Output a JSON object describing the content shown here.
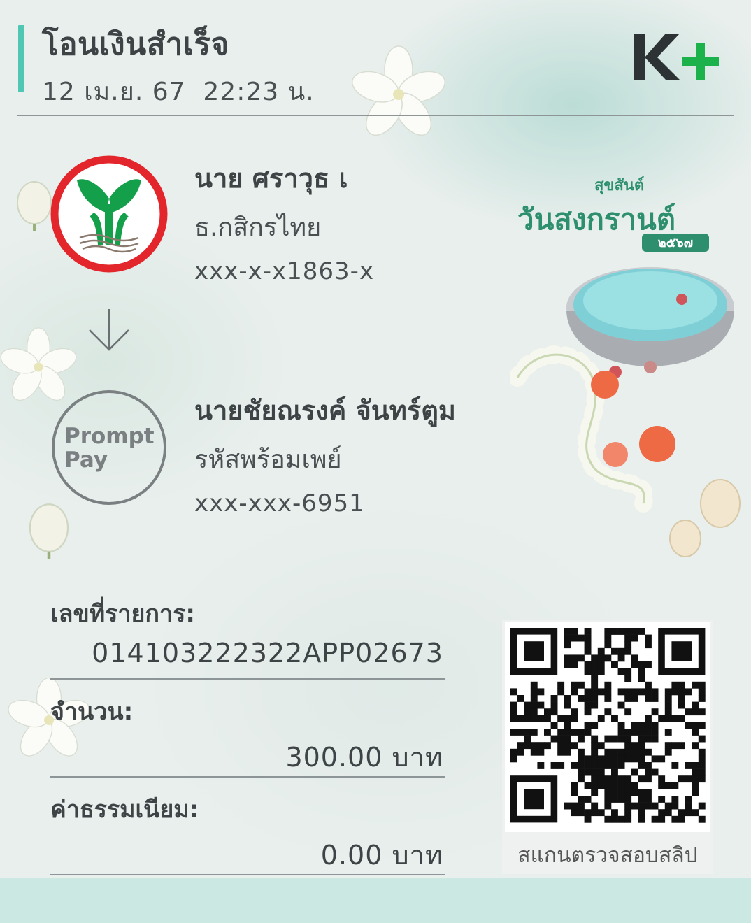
{
  "header": {
    "title": "โอนเงินสำเร็จ",
    "datetime": "12 เม.ย. 67  22:23 น.",
    "brand_logo": "K+"
  },
  "sender": {
    "name": "นาย ศราวุธ เ",
    "bank": "ธ.กสิกรไทย",
    "account": "xxx-x-x1863-x",
    "logo_icon": "kasikorn-bank-logo"
  },
  "transfer_arrow_icon": "arrow-down-icon",
  "receiver": {
    "name": "นายชัยณรงค์ จันทร์ตูม",
    "bank": "รหัสพร้อมเพย์",
    "account": "xxx-xxx-6951",
    "logo_icon": "promptpay-logo",
    "logo_text_line1": "Prompt",
    "logo_text_line2": "Pay"
  },
  "details": [
    {
      "label": "เลขที่รายการ:",
      "value": "014103222322APP02673"
    },
    {
      "label": "จำนวน:",
      "value": "300.00 บาท"
    },
    {
      "label": "ค่าธรรมเนียม:",
      "value": "0.00 บาท"
    }
  ],
  "qr": {
    "caption": "สแกนตรวจสอบสลิป"
  },
  "festival": {
    "line1": "สุขสันต์",
    "line2": "วันสงกรานต์",
    "year": "๒๕๖๗"
  },
  "colors": {
    "accent": "#4fc7b2",
    "kbank_green": "#14a04a",
    "kbank_red": "#e3262b",
    "kplus_green": "#1bb24b",
    "kplus_dark": "#2d3234",
    "festive_green": "#2d8f6e"
  }
}
